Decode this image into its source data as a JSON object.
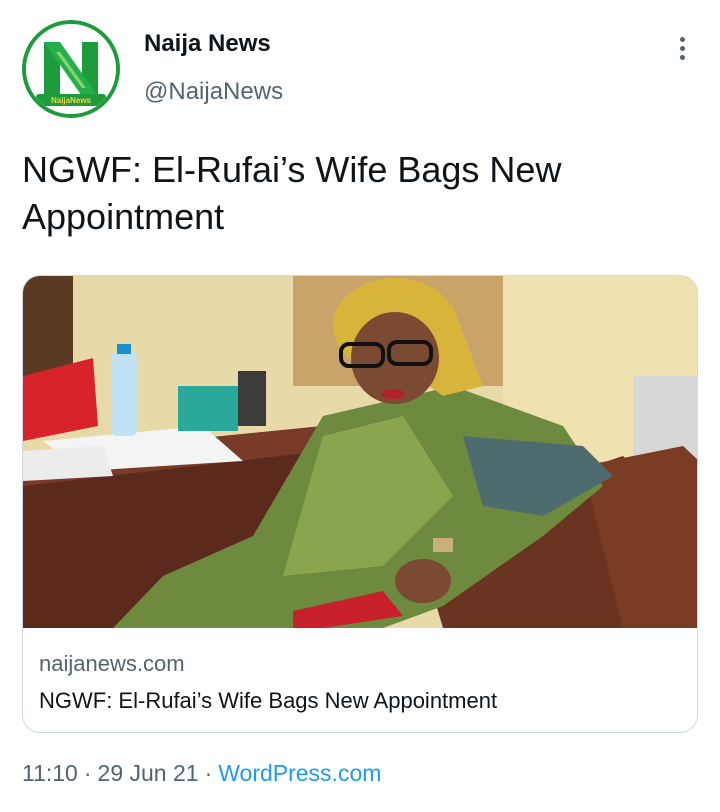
{
  "account": {
    "name": "Naija News",
    "handle": "@NaijaNews",
    "avatar_text": "NaijaNews",
    "avatar_icon": "naija-news-logo"
  },
  "menu": {
    "icon": "more-vertical-icon"
  },
  "tweet": {
    "text": "NGWF: El-Rufai’s Wife Bags New Appointment"
  },
  "card": {
    "image_alt": "Woman in head wrap reading at a desk",
    "domain": "naijanews.com",
    "title": "NGWF: El-Rufai’s Wife Bags New Appointment"
  },
  "meta": {
    "time": "11:10",
    "date": "29 Jun 21",
    "separator": "·",
    "source": "WordPress.com"
  },
  "colors": {
    "brand_green": "#1e9c3c",
    "link_blue": "#1d9bf0",
    "secondary_text": "#536471"
  }
}
